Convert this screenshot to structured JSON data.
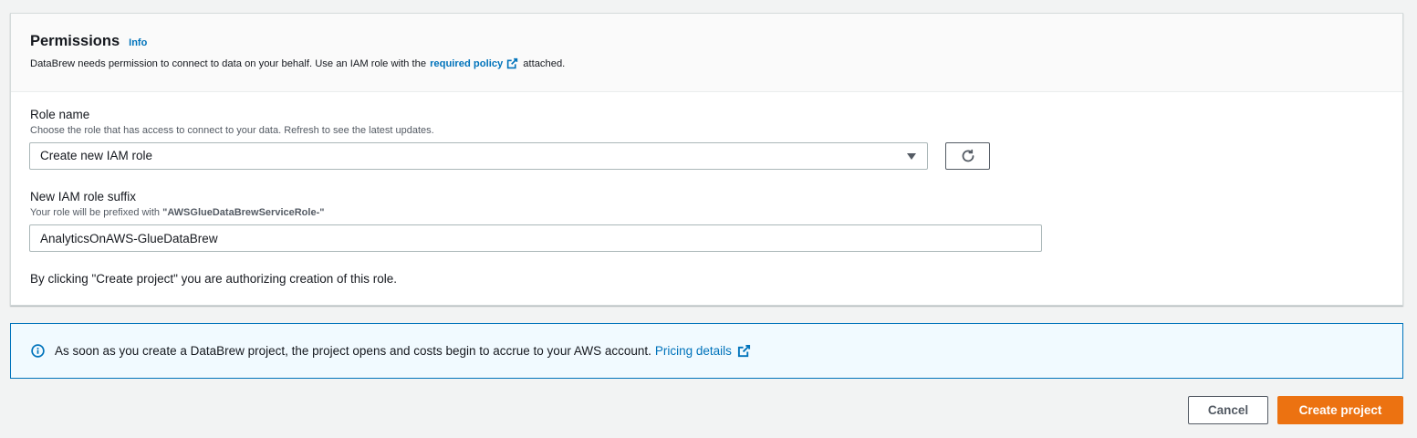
{
  "permissions": {
    "title": "Permissions",
    "info_label": "Info",
    "description_prefix": "DataBrew needs permission to connect to data on your behalf. Use an IAM role with the",
    "description_link": "required policy",
    "description_suffix": "attached."
  },
  "role_name": {
    "label": "Role name",
    "hint": "Choose the role that has access to connect to your data. Refresh to see the latest updates.",
    "selected_value": "Create new IAM role"
  },
  "role_suffix": {
    "label": "New IAM role suffix",
    "hint_prefix": "Your role will be prefixed with",
    "hint_prefix_value": "\"AWSGlueDataBrewServiceRole-\"",
    "value": "AnalyticsOnAWS-GlueDataBrew"
  },
  "consent_text": "By clicking \"Create project\" you are authorizing creation of this role.",
  "alert": {
    "message": "As soon as you create a DataBrew project, the project opens and costs begin to accrue to your AWS account.",
    "link_label": "Pricing details"
  },
  "actions": {
    "cancel_label": "Cancel",
    "create_label": "Create project"
  },
  "colors": {
    "link": "#0073bb",
    "primary_button": "#ec7211",
    "alert_background": "#f1faff",
    "alert_border": "#0073bb"
  },
  "icons": [
    "external-link-icon",
    "select-caret-icon",
    "refresh-icon",
    "info-circle-icon"
  ]
}
